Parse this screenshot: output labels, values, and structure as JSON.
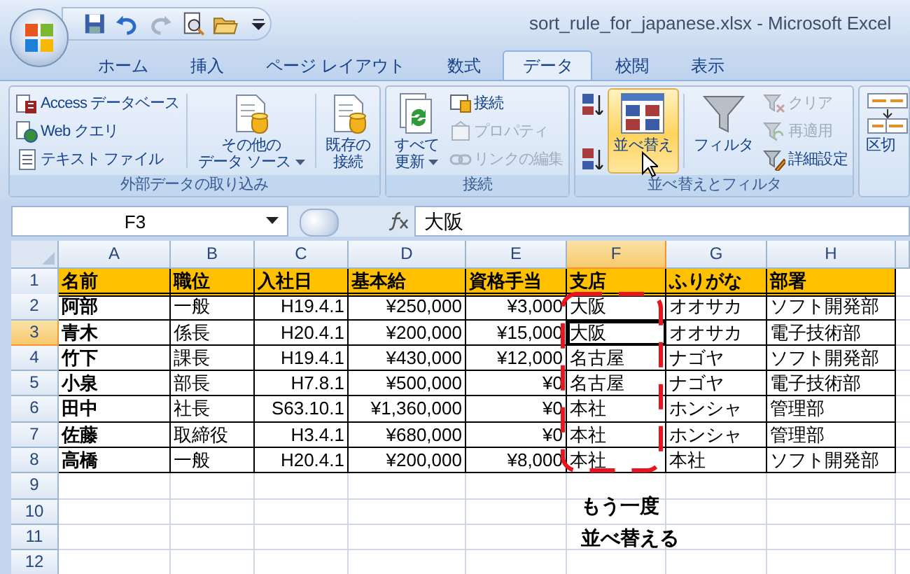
{
  "window": {
    "title": "sort_rule_for_japanese.xlsx - Microsoft Excel"
  },
  "ribbon": {
    "tabs": [
      {
        "label": "ホーム",
        "selected": false
      },
      {
        "label": "挿入",
        "selected": false
      },
      {
        "label": "ページ レイアウト",
        "selected": false
      },
      {
        "label": "数式",
        "selected": false
      },
      {
        "label": "データ",
        "selected": true
      },
      {
        "label": "校閲",
        "selected": false
      },
      {
        "label": "表示",
        "selected": false
      }
    ],
    "groups": [
      {
        "label": "外部データの取り込み",
        "items": [
          {
            "kind": "small",
            "label": "Access データベース",
            "disabled": false
          },
          {
            "kind": "small",
            "label": "Web クエリ",
            "disabled": false
          },
          {
            "kind": "small",
            "label": "テキスト ファイル",
            "disabled": false
          },
          {
            "kind": "large",
            "lines": [
              "その他の",
              "データ ソース"
            ],
            "dropdown": true,
            "selected": false
          },
          {
            "kind": "large",
            "lines": [
              "既存の",
              "接続"
            ],
            "dropdown": false,
            "selected": false
          }
        ]
      },
      {
        "label": "接続",
        "items": [
          {
            "kind": "large",
            "lines": [
              "すべて",
              "更新"
            ],
            "dropdown": true,
            "selected": false
          },
          {
            "kind": "small",
            "label": "接続",
            "disabled": false
          },
          {
            "kind": "small",
            "label": "プロパティ",
            "disabled": true
          },
          {
            "kind": "small",
            "label": "リンクの編集",
            "disabled": true
          }
        ]
      },
      {
        "label": "並べ替えとフィルタ",
        "items": [
          {
            "kind": "icon"
          },
          {
            "kind": "icon"
          },
          {
            "kind": "large",
            "lines": [
              "並べ替え"
            ],
            "dropdown": false,
            "selected": true
          },
          {
            "kind": "large",
            "lines": [
              "フィルタ"
            ],
            "dropdown": false,
            "selected": false
          },
          {
            "kind": "small",
            "label": "クリア",
            "disabled": true
          },
          {
            "kind": "small",
            "label": "再適用",
            "disabled": true
          },
          {
            "kind": "small",
            "label": "詳細設定",
            "disabled": false
          }
        ]
      },
      {
        "items": [
          {
            "kind": "large",
            "lines": [
              "区切"
            ],
            "dropdown": false,
            "selected": false
          }
        ]
      }
    ]
  },
  "sheet": {
    "name_box": "F3",
    "formula": "大阪",
    "columns": [
      {
        "header": "A",
        "kind": "key",
        "selected": false
      },
      {
        "header": "B",
        "kind": "text",
        "selected": false
      },
      {
        "header": "C",
        "kind": "number",
        "selected": false
      },
      {
        "header": "D",
        "kind": "number",
        "selected": false
      },
      {
        "header": "E",
        "kind": "number",
        "selected": false
      },
      {
        "header": "F",
        "kind": "text",
        "selected": true
      },
      {
        "header": "G",
        "kind": "text",
        "selected": false
      },
      {
        "header": "H",
        "kind": "text",
        "selected": false
      }
    ],
    "rows": [
      {
        "header": "1",
        "kind": "header",
        "selected": false,
        "cells": [
          "名前",
          "職位",
          "入社日",
          "基本給",
          "資格手当",
          "支店",
          "ふりがな",
          "部署"
        ]
      },
      {
        "header": "2",
        "kind": "data",
        "selected": false,
        "cells": [
          "阿部",
          "一般",
          "H19.4.1",
          "¥250,000",
          "¥3,000",
          "大阪",
          "オオサカ",
          "ソフト開発部"
        ]
      },
      {
        "header": "3",
        "kind": "data",
        "selected": true,
        "cells": [
          "青木",
          "係長",
          "H20.4.1",
          "¥200,000",
          "¥15,000",
          "大阪",
          "オオサカ",
          "電子技術部"
        ]
      },
      {
        "header": "4",
        "kind": "data",
        "selected": false,
        "cells": [
          "竹下",
          "課長",
          "H19.4.1",
          "¥430,000",
          "¥12,000",
          "名古屋",
          "ナゴヤ",
          "ソフト開発部"
        ]
      },
      {
        "header": "5",
        "kind": "data",
        "selected": false,
        "cells": [
          "小泉",
          "部長",
          "H7.8.1",
          "¥500,000",
          "¥0",
          "名古屋",
          "ナゴヤ",
          "電子技術部"
        ]
      },
      {
        "header": "6",
        "kind": "data",
        "selected": false,
        "cells": [
          "田中",
          "社長",
          "S63.10.1",
          "¥1,360,000",
          "¥0",
          "本社",
          "ホンシャ",
          "管理部"
        ]
      },
      {
        "header": "7",
        "kind": "data",
        "selected": false,
        "cells": [
          "佐藤",
          "取締役",
          "H3.4.1",
          "¥680,000",
          "¥0",
          "本社",
          "ホンシャ",
          "管理部"
        ]
      },
      {
        "header": "8",
        "kind": "data",
        "selected": false,
        "cells": [
          "高橋",
          "一般",
          "H20.4.1",
          "¥200,000",
          "¥8,000",
          "本社",
          "本社",
          "ソフト開発部"
        ]
      },
      {
        "header": "9",
        "kind": "empty",
        "selected": false
      },
      {
        "header": "10",
        "kind": "empty",
        "selected": false
      },
      {
        "header": "11",
        "kind": "empty",
        "selected": false
      },
      {
        "header": "12",
        "kind": "empty",
        "selected": false
      }
    ],
    "note": {
      "lines": [
        "もう一度",
        "並べ替える"
      ]
    }
  }
}
